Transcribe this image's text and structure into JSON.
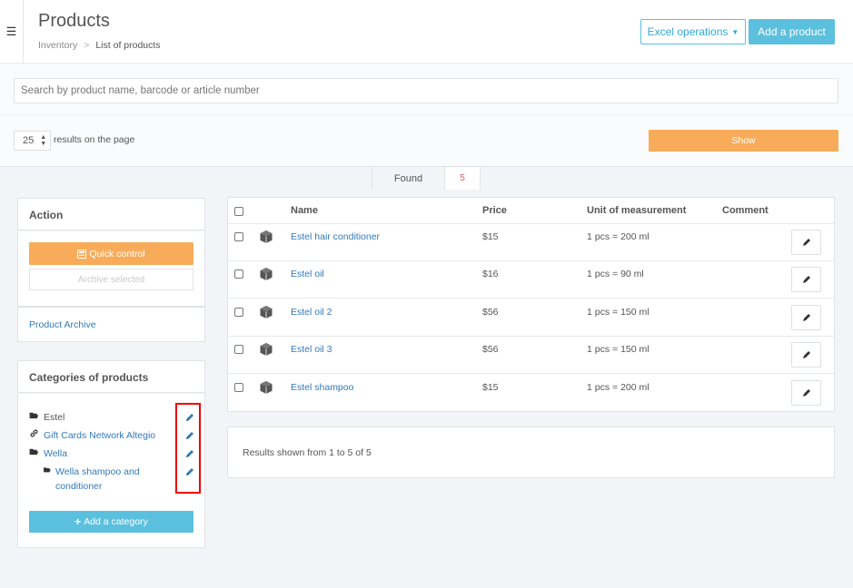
{
  "header": {
    "menu_icon": "hamburger-icon",
    "title": "Products",
    "breadcrumb": [
      "Inventory",
      "List of products"
    ],
    "breadcrumb_sep": ">",
    "excel_label": "Excel operations",
    "add_product_label": "Add a product"
  },
  "search": {
    "placeholder": "Search by product name, barcode or article number",
    "value": ""
  },
  "pagination": {
    "per_page": "25",
    "label": "results on the page",
    "show_label": "Show"
  },
  "found": {
    "label": "Found",
    "count": "5"
  },
  "action": {
    "title": "Action",
    "quick_control": "Quick control",
    "archive_selected": "Archive selected",
    "product_archive": "Product Archive"
  },
  "categories": {
    "title": "Categories of products",
    "items": [
      {
        "label": "Estel",
        "icon": "folder-open-icon"
      },
      {
        "label": "Gift Cards Network Altegio",
        "icon": "link-icon"
      },
      {
        "label": "Wella",
        "icon": "folder-open-icon"
      },
      {
        "label": "Wella shampoo and conditioner",
        "icon": "folder-open-icon"
      }
    ],
    "add_label": "Add a category"
  },
  "table": {
    "headers": {
      "name": "Name",
      "price": "Price",
      "unit": "Unit of measurement",
      "comment": "Comment"
    },
    "rows": [
      {
        "name": "Estel hair conditioner",
        "price": "$15",
        "unit": "1 pcs = 200 ml",
        "comment": ""
      },
      {
        "name": "Estel oil",
        "price": "$16",
        "unit": "1 pcs = 90 ml",
        "comment": ""
      },
      {
        "name": "Estel oil 2",
        "price": "$56",
        "unit": "1 pcs = 150 ml",
        "comment": ""
      },
      {
        "name": "Estel oil 3",
        "price": "$56",
        "unit": "1 pcs = 150 ml",
        "comment": ""
      },
      {
        "name": "Estel shampoo",
        "price": "$15",
        "unit": "1 pcs = 200 ml",
        "comment": ""
      }
    ]
  },
  "results_text": "Results shown from 1 to 5 of 5",
  "colors": {
    "accent_blue": "#5bc0de",
    "link_blue": "#337ab7",
    "orange": "#f8ac59",
    "found_red": "#ed5565",
    "highlight_red": "#e00000"
  }
}
